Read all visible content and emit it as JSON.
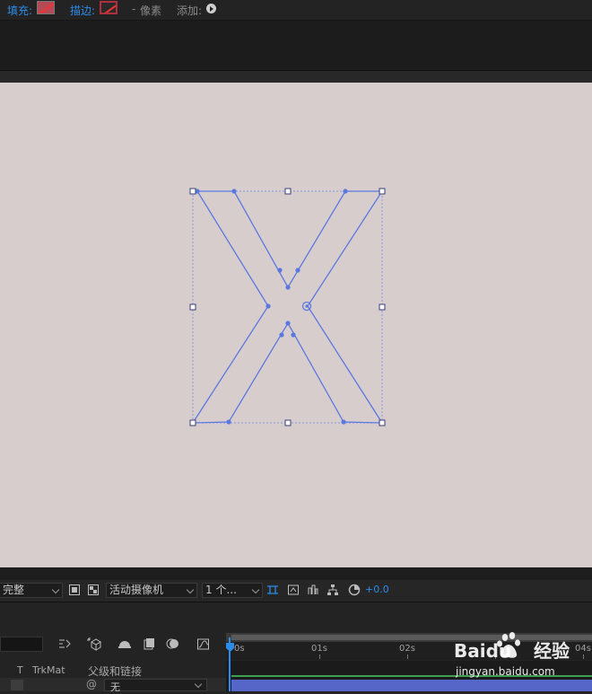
{
  "toolbar": {
    "fill_label": "填充:",
    "stroke_label": "描边:",
    "stroke_width": "-",
    "stroke_unit": "像素",
    "add_label": "添加:"
  },
  "viewer": {
    "resolution": "完整",
    "camera": "活动摄像机",
    "views": "1 个...",
    "exposure": "+0.0"
  },
  "timeline": {
    "col_t": "T",
    "col_trkmat": "TrkMat",
    "col_parent": "父级和链接",
    "parent_value": "无",
    "ticks": [
      "0s",
      "01s",
      "02s",
      "04s"
    ]
  },
  "watermark": {
    "brand": "Baidu",
    "brand_suffix": "经验",
    "url": "jingyan.baidu.com"
  },
  "colors": {
    "accent": "#2d8ceb",
    "path": "#5b78e0",
    "canvas": "#d8cdcd",
    "layer_bar": "#5566c8",
    "green": "#3f9e4f"
  }
}
